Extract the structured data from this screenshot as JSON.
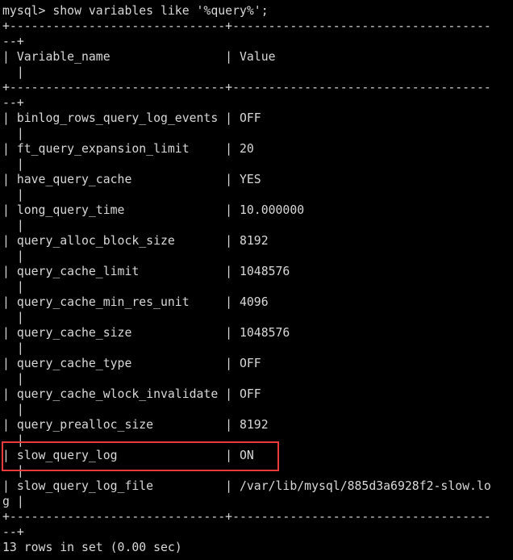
{
  "terminal": {
    "lines": [
      "mysql> show variables like '%query%';",
      "+------------------------------+------------------------------------",
      "--+",
      "| Variable_name                | Value",
      "  |",
      "+------------------------------+------------------------------------",
      "--+",
      "| binlog_rows_query_log_events | OFF",
      "  |",
      "| ft_query_expansion_limit     | 20",
      "  |",
      "| have_query_cache             | YES",
      "  |",
      "| long_query_time              | 10.000000",
      "  |",
      "| query_alloc_block_size       | 8192",
      "  |",
      "| query_cache_limit            | 1048576",
      "  |",
      "| query_cache_min_res_unit     | 4096",
      "  |",
      "| query_cache_size             | 1048576",
      "  |",
      "| query_cache_type             | OFF",
      "  |",
      "| query_cache_wlock_invalidate | OFF",
      "  |",
      "| query_prealloc_size          | 8192",
      "  |",
      "| slow_query_log               | ON",
      "  |",
      "| slow_query_log_file          | /var/lib/mysql/885d3a6928f2-slow.lo",
      "g |",
      "+------------------------------+------------------------------------",
      "--+",
      "13 rows in set (0.00 sec)"
    ]
  },
  "colors": {
    "background": "#000000",
    "text": "#d8d8d8",
    "highlight": "#e83c3c"
  }
}
